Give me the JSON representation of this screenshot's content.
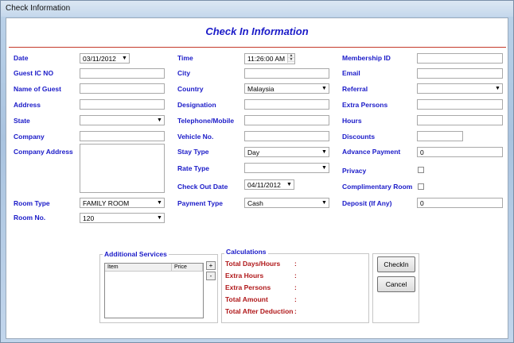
{
  "window": {
    "title": "Check Information"
  },
  "form": {
    "title": "Check In Information"
  },
  "col1": {
    "date": {
      "label": "Date",
      "value": "03/11/2012"
    },
    "guest_ic": {
      "label": "Guest IC NO",
      "value": ""
    },
    "guest_name": {
      "label": "Name of Guest",
      "value": ""
    },
    "address": {
      "label": "Address",
      "value": ""
    },
    "state": {
      "label": "State",
      "value": ""
    },
    "company": {
      "label": "Company",
      "value": ""
    },
    "company_address": {
      "label": "Company Address",
      "value": ""
    },
    "room_type": {
      "label": "Room Type",
      "value": "FAMILY ROOM"
    },
    "room_no": {
      "label": "Room No.",
      "value": "120"
    }
  },
  "col2": {
    "time": {
      "label": "Time",
      "value": "11:26:00 AM"
    },
    "city": {
      "label": "City",
      "value": ""
    },
    "country": {
      "label": "Country",
      "value": "Malaysia"
    },
    "designation": {
      "label": "Designation",
      "value": ""
    },
    "telephone": {
      "label": "Telephone/Mobile",
      "value": ""
    },
    "vehicle": {
      "label": "Vehicle No.",
      "value": ""
    },
    "stay_type": {
      "label": "Stay Type",
      "value": "Day"
    },
    "rate_type": {
      "label": "Rate Type",
      "value": ""
    },
    "checkout_date": {
      "label": "Check Out Date",
      "value": "04/11/2012"
    },
    "payment_type": {
      "label": "Payment Type",
      "value": "Cash"
    }
  },
  "col3": {
    "membership": {
      "label": "Membership ID",
      "value": ""
    },
    "email": {
      "label": "Email",
      "value": ""
    },
    "referral": {
      "label": "Referral",
      "value": ""
    },
    "extra_persons": {
      "label": "Extra Persons",
      "value": ""
    },
    "hours": {
      "label": "Hours",
      "value": ""
    },
    "discounts": {
      "label": "Discounts",
      "value": ""
    },
    "advance_payment": {
      "label": "Advance Payment",
      "value": "0"
    },
    "privacy": {
      "label": "Privacy",
      "checked": false
    },
    "complimentary": {
      "label": "Complimentary Room",
      "checked": false
    },
    "deposit": {
      "label": "Deposit (If Any)",
      "value": "0"
    }
  },
  "additional_services": {
    "title": "Additional Services",
    "columns": [
      "Item",
      "Price"
    ],
    "add_label": "+",
    "remove_label": "-"
  },
  "calculations": {
    "title": "Calculations",
    "rows": [
      {
        "label": "Total Days/Hours",
        "sep": ":"
      },
      {
        "label": "Extra Hours",
        "sep": ":"
      },
      {
        "label": "Extra Persons",
        "sep": ":"
      },
      {
        "label": "Total Amount",
        "sep": ":"
      },
      {
        "label": "Total After Deduction",
        "sep": ":"
      }
    ]
  },
  "actions": {
    "checkin_label": "CheckIn",
    "cancel_label": "Cancel"
  },
  "icons": {
    "dropdown": "chevron-down-icon",
    "spinner": "spin-arrows-icon"
  }
}
